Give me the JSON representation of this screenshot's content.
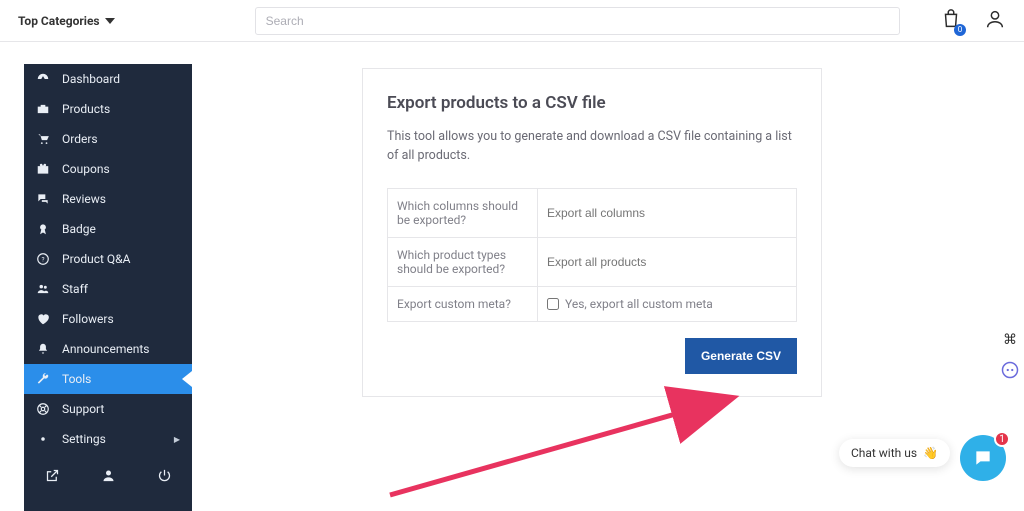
{
  "header": {
    "top_categories_label": "Top Categories",
    "search_placeholder": "Search",
    "bag_count": "0"
  },
  "sidebar": {
    "items": [
      {
        "label": "Dashboard"
      },
      {
        "label": "Products"
      },
      {
        "label": "Orders"
      },
      {
        "label": "Coupons"
      },
      {
        "label": "Reviews"
      },
      {
        "label": "Badge"
      },
      {
        "label": "Product Q&A"
      },
      {
        "label": "Staff"
      },
      {
        "label": "Followers"
      },
      {
        "label": "Announcements"
      },
      {
        "label": "Tools"
      },
      {
        "label": "Support"
      },
      {
        "label": "Settings"
      }
    ]
  },
  "export": {
    "title": "Export products to a CSV file",
    "description": "This tool allows you to generate and download a CSV file containing a list of all products.",
    "rows": {
      "columns_label": "Which columns should be exported?",
      "columns_placeholder": "Export all columns",
      "types_label": "Which product types should be exported?",
      "types_placeholder": "Export all products",
      "meta_label": "Export custom meta?",
      "meta_checkbox_label": "Yes, export all custom meta"
    },
    "button": "Generate CSV"
  },
  "chat": {
    "pill_text": "Chat with us",
    "pill_emoji": "👋",
    "badge": "1"
  }
}
